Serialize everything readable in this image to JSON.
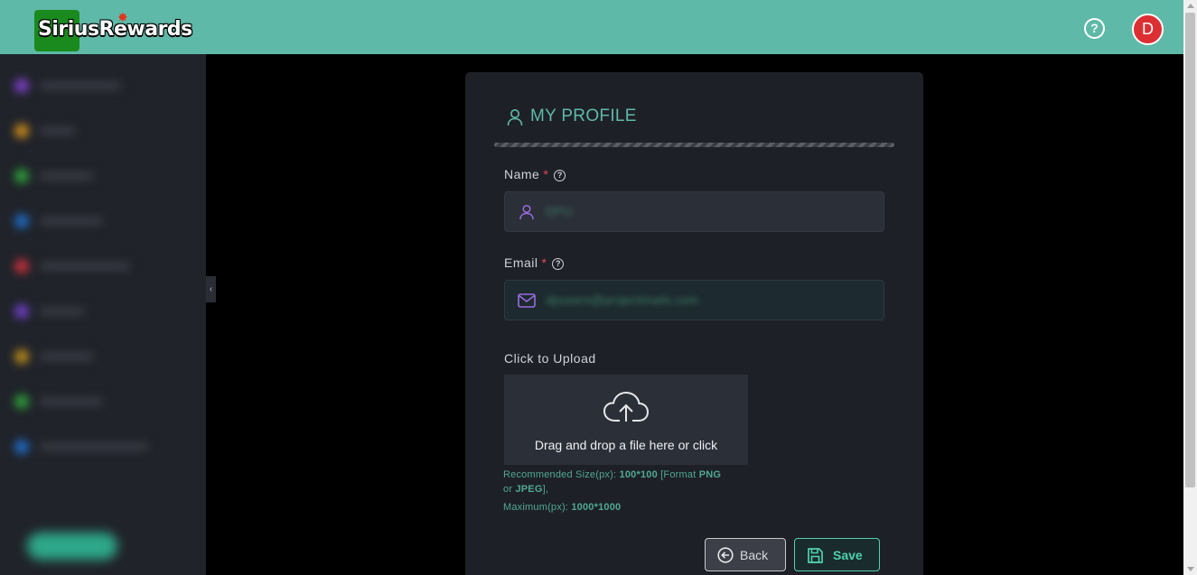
{
  "header": {
    "logo_text": "SiriusRewards",
    "help_icon": "question-circle-icon",
    "avatar_initial": "D",
    "avatar_color": "#dc2f33",
    "bar_color": "#5fb9a8"
  },
  "sidebar": {
    "collapse_icon": "chevron-left-icon",
    "item_colors": [
      "#7b3fc4",
      "#c98a1b",
      "#2e9d3a",
      "#1f6bc4",
      "#c4303b",
      "#6c3fc4",
      "#b88a1b",
      "#2e9d3a",
      "#1f6bc4"
    ]
  },
  "profile": {
    "title": "MY PROFILE",
    "title_icon": "user-icon",
    "name_label": "Name",
    "email_label": "Email",
    "required_mark": "*",
    "name_value": "DPU",
    "email_value": "dpusers@projectmails.com",
    "upload_label": "Click to Upload",
    "upload_text": "Drag and drop a file here or click",
    "hint": {
      "rec_prefix": "Recommended Size(px): ",
      "rec_size": "100*100",
      "rec_format_prefix": " [Format ",
      "format_png": "PNG",
      "or": "or ",
      "format_jpeg": "JPEG",
      "format_suffix": "],",
      "max_prefix": "Maximum(px): ",
      "max_size": "1000*1000"
    },
    "back_label": "Back",
    "save_label": "Save"
  }
}
